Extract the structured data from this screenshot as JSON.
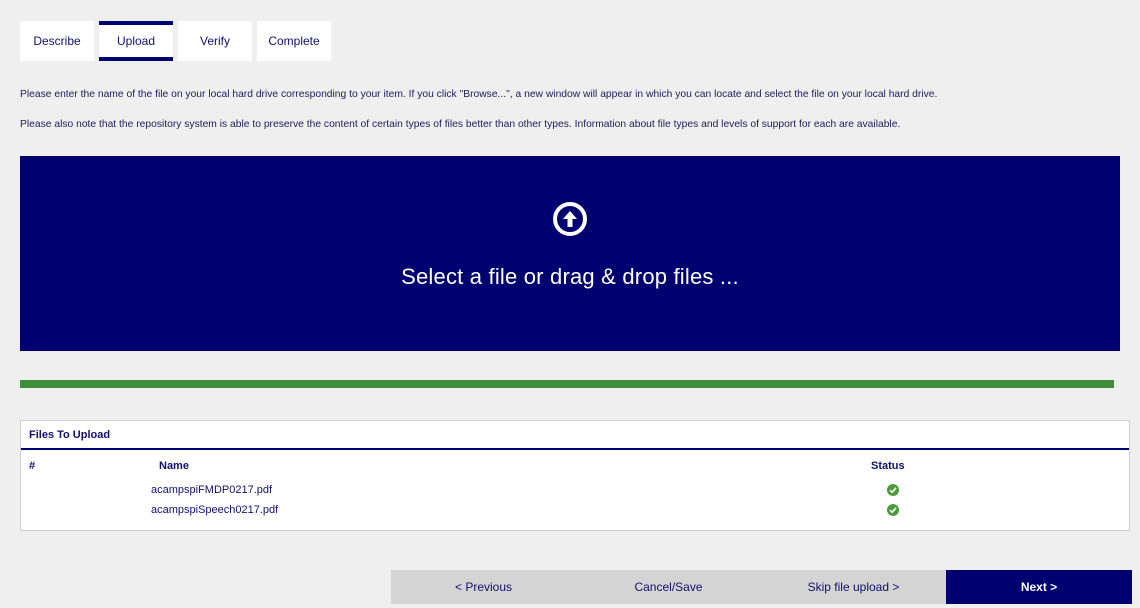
{
  "steps": [
    {
      "label": "Describe",
      "active": false
    },
    {
      "label": "Upload",
      "active": true
    },
    {
      "label": "Verify",
      "active": false
    },
    {
      "label": "Complete",
      "active": false
    }
  ],
  "instructions": [
    "Please enter the name of the file on your local hard drive corresponding to your item. If you click \"Browse...\", a new window will appear in which you can locate and select the file on your local hard drive.",
    "Please also note that the repository system is able to preserve the content of certain types of files better than other types. Information about file types and levels of support for each are available."
  ],
  "dropzone": {
    "icon": "arrow-up-circle-icon",
    "text": "Select a file or drag & drop files ..."
  },
  "upload_progress": 1.0,
  "files_panel": {
    "title": "Files To Upload",
    "columns": [
      "#",
      "Name",
      "Status"
    ],
    "files": [
      {
        "name": "acampspiFMDP0217.pdf",
        "status": "check-icon"
      },
      {
        "name": "acampspiSpeech0217.pdf",
        "status": "check-icon"
      }
    ]
  },
  "navigation": {
    "previous": "< Previous",
    "cancel": "Cancel/Save",
    "skip": "Skip file upload >",
    "next": "Next >"
  },
  "colors": {
    "primary": "#000070",
    "progress": "#3e8e3e",
    "success": "#4c9a3c"
  }
}
